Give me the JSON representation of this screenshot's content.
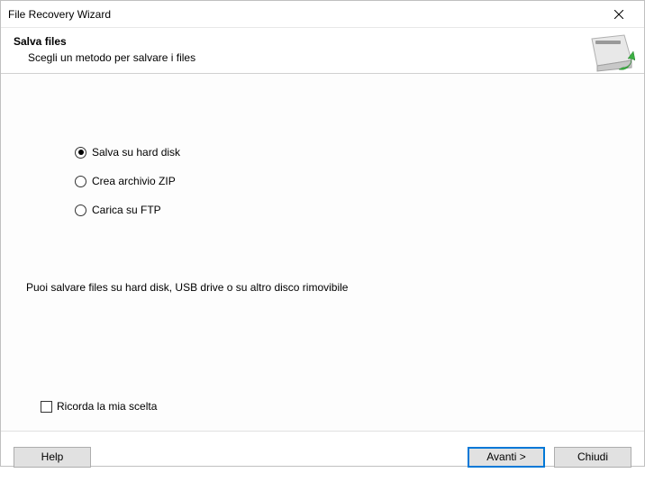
{
  "window": {
    "title": "File Recovery Wizard"
  },
  "header": {
    "title": "Salva files",
    "subtitle": "Scegli un metodo per salvare i files"
  },
  "options": [
    {
      "label": "Salva su hard disk",
      "checked": true
    },
    {
      "label": "Crea archivio ZIP",
      "checked": false
    },
    {
      "label": "Carica su FTP",
      "checked": false
    }
  ],
  "description": "Puoi salvare files su hard disk, USB drive o su altro disco rimovibile",
  "remember": {
    "label": "Ricorda la mia scelta",
    "checked": false
  },
  "footer": {
    "help": "Help",
    "next": "Avanti >",
    "close": "Chiudi"
  }
}
